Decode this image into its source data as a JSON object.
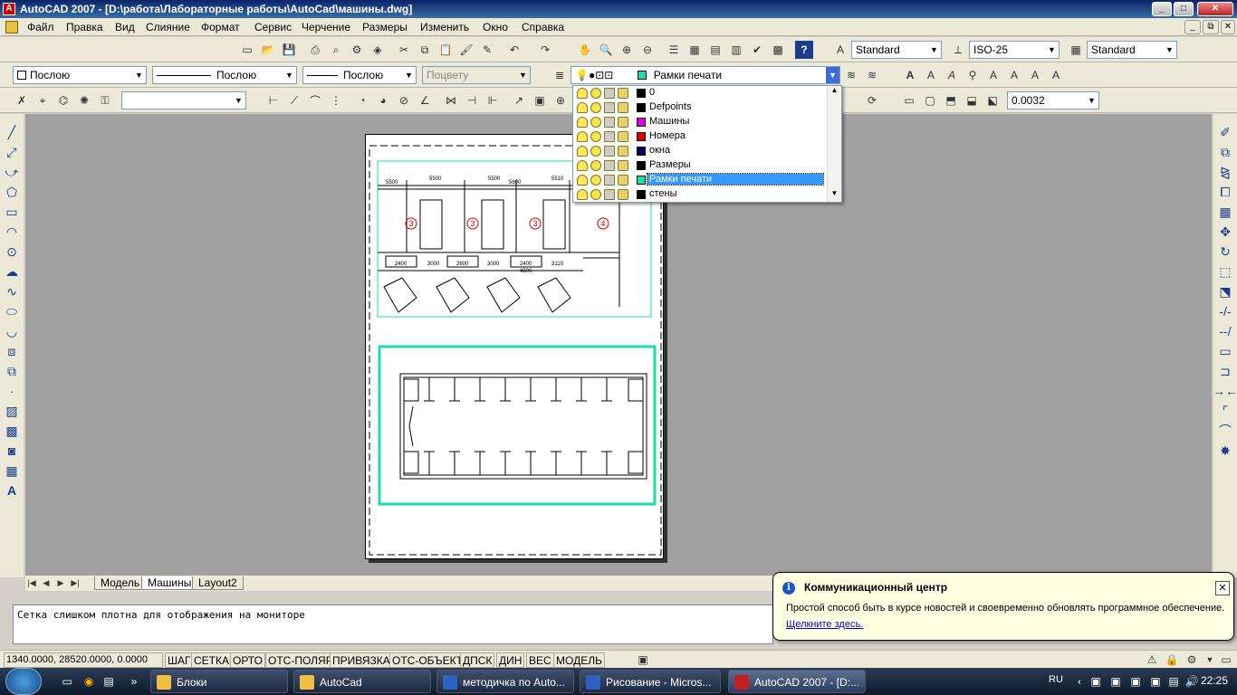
{
  "window": {
    "title": "AutoCAD 2007 - [D:\\работа\\Лабораторные работы\\AutoCad\\машины.dwg]",
    "minimize": "_",
    "maximize": "□",
    "close": "✕",
    "doc_min": "_",
    "doc_max": "⧉",
    "doc_close": "✕"
  },
  "menu": [
    "Файл",
    "Правка",
    "Вид",
    "Слияние",
    "Формат",
    "Сервис",
    "Черчение",
    "Размеры",
    "Изменить",
    "Окно",
    "Справка"
  ],
  "styles": {
    "text_style": "Standard",
    "dim_style": "ISO-25",
    "table_style": "Standard"
  },
  "properties": {
    "color": "Послою",
    "linetype": "Послою",
    "lineweight": "Послою",
    "plotstyle": "Поцвету"
  },
  "layer_current": {
    "name": "Рамки печати",
    "color": "#16e0b0"
  },
  "layers": [
    {
      "name": "0",
      "color": "#000000"
    },
    {
      "name": "Defpoints",
      "color": "#000000"
    },
    {
      "name": "Машины",
      "color": "#e000e0"
    },
    {
      "name": "Номера",
      "color": "#e00000"
    },
    {
      "name": "окна",
      "color": "#000060"
    },
    {
      "name": "Размеры",
      "color": "#000000"
    },
    {
      "name": "Рамки печати",
      "color": "#16e0b0"
    },
    {
      "name": "стены",
      "color": "#000000"
    }
  ],
  "dim_scale": "0.0032",
  "drawing": {
    "dims_top": [
      "5500",
      "5500",
      "5500",
      "5600",
      "5510"
    ],
    "dims_bottom": [
      "2400",
      "3000",
      "2600",
      "3000",
      "2400",
      "3110",
      "4500"
    ],
    "bay_numbers": [
      "3",
      "3",
      "3",
      "4"
    ]
  },
  "layout_tabs": [
    "Модель",
    "Машины",
    "Layout2"
  ],
  "command_line": "Сетка слишком плотна для отображения на мониторе",
  "status": {
    "coords": "1340.0000,  28520.0000, 0.0000",
    "toggles": [
      "ШАГ",
      "СЕТКА",
      "ОРТО",
      "ОТС-ПОЛЯР",
      "ПРИВЯЗКА",
      "ОТС-ОБЪЕКТ",
      "ДПСК",
      "ДИН",
      "ВЕС",
      "МОДЕЛЬ"
    ]
  },
  "balloon": {
    "title": "Коммуникационный центр",
    "text": "Простой способ быть в курсе новостей и своевременно обновлять программное обеспечение.",
    "link": "Щелкните здесь."
  },
  "taskbar": {
    "tasks": [
      {
        "label": "Блоки",
        "icon_color": "#f0c040"
      },
      {
        "label": "AutoCad",
        "icon_color": "#f0c040"
      },
      {
        "label": "методичка по Auto...",
        "icon_color": "#3060c0"
      },
      {
        "label": "Рисование - Micros...",
        "icon_color": "#3060c0"
      },
      {
        "label": "AutoCAD 2007 - [D:...",
        "icon_color": "#c02020"
      }
    ],
    "lang": "RU",
    "clock": "22:25"
  }
}
